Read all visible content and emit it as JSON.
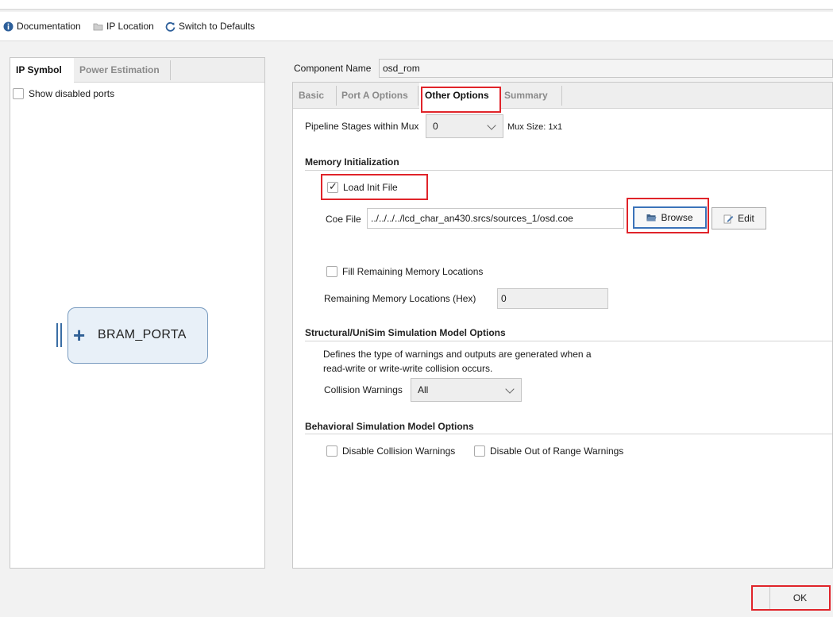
{
  "toolbar": {
    "documentation": "Documentation",
    "ip_location": "IP Location",
    "switch_defaults": "Switch to Defaults"
  },
  "left_panel": {
    "tabs": [
      "IP Symbol",
      "Power Estimation"
    ],
    "show_disabled_ports": "Show disabled ports",
    "show_disabled_checked": false,
    "block_label": "BRAM_PORTA"
  },
  "component": {
    "label": "Component Name",
    "value": "osd_rom"
  },
  "tabs": [
    "Basic",
    "Port A Options",
    "Other Options",
    "Summary"
  ],
  "active_tab": "Other Options",
  "pipeline": {
    "label": "Pipeline Stages within Mux",
    "value": "0",
    "mux_size": "Mux Size: 1x1"
  },
  "memory_init": {
    "title": "Memory Initialization",
    "load_init_label": "Load Init File",
    "load_init_checked": true,
    "coe_label": "Coe File",
    "coe_value": "../../../../lcd_char_an430.srcs/sources_1/osd.coe",
    "browse_label": "Browse",
    "edit_label": "Edit",
    "fill_label": "Fill Remaining Memory Locations",
    "fill_checked": false,
    "remaining_label": "Remaining Memory Locations (Hex)",
    "remaining_value": "0"
  },
  "structural": {
    "title": "Structural/UniSim Simulation Model Options",
    "desc_line1": "Defines the type of warnings and outputs are generated when a",
    "desc_line2": "read-write or write-write collision occurs.",
    "collision_label": "Collision Warnings",
    "collision_value": "All"
  },
  "behavioral": {
    "title": "Behavioral Simulation Model Options",
    "disable_collision": "Disable Collision Warnings",
    "disable_out_of_range": "Disable Out of Range Warnings"
  },
  "footer": {
    "ok": "OK"
  },
  "colors": {
    "highlight": "#e0242a",
    "accent": "#3b73b9"
  }
}
